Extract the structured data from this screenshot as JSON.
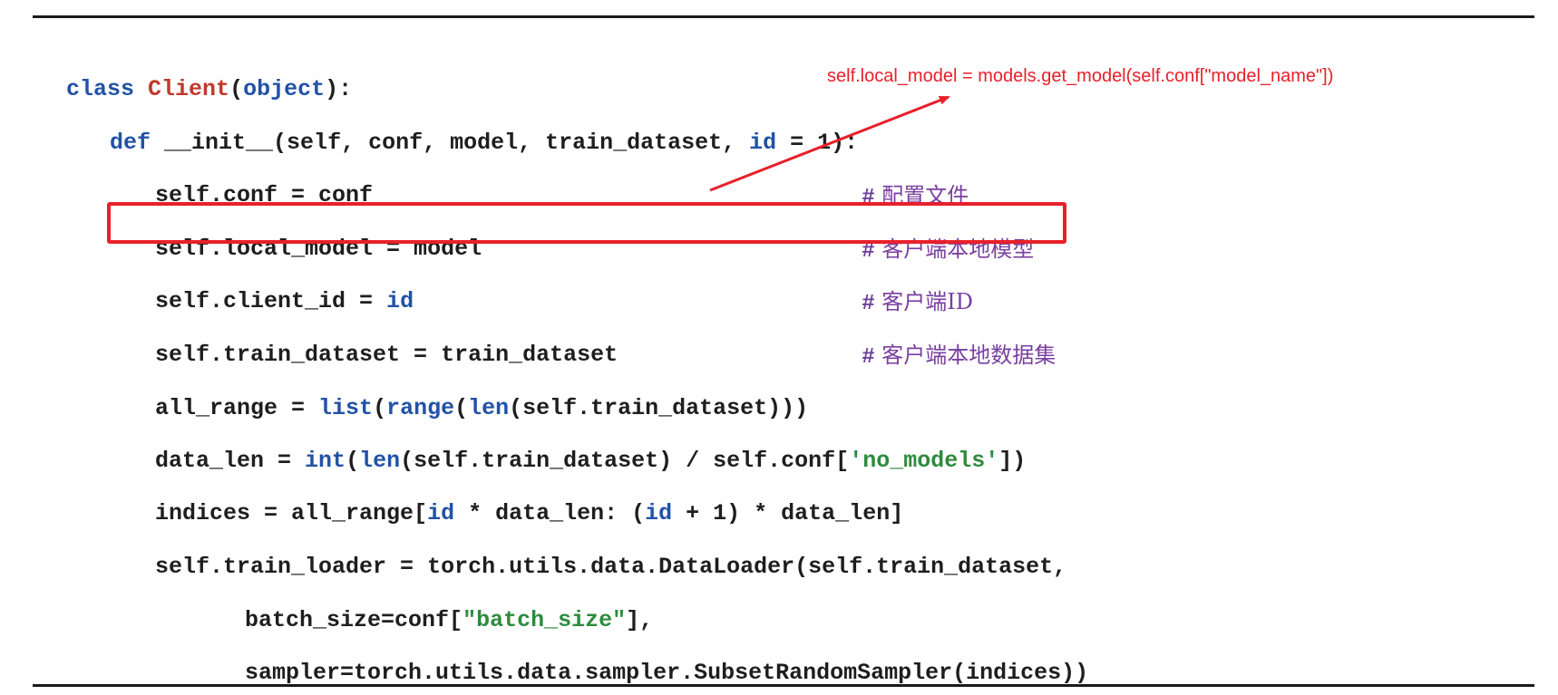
{
  "annotation": {
    "text": "self.local_model = models.get_model(self.conf[\"model_name\"])"
  },
  "code": {
    "line1": {
      "kw_class": "class",
      "name": "Client",
      "open": "(",
      "base": "object",
      "close": "):"
    },
    "line2": {
      "kw_def": "def",
      "sig": " __init__(self, conf, model, train_dataset, ",
      "id_kw": "id",
      "rest": " = 1):"
    },
    "line3": {
      "text": "self.conf = conf"
    },
    "line4": {
      "text": "self.local_model = model"
    },
    "line5": {
      "pre": "self.client_id = ",
      "id_kw": "id"
    },
    "line6": {
      "text": "self.train_dataset = train_dataset"
    },
    "line7": {
      "pre": "all_range = ",
      "f1": "list",
      "p1": "(",
      "f2": "range",
      "p2": "(",
      "f3": "len",
      "rest": "(self.train_dataset)))"
    },
    "line8": {
      "pre": "data_len = ",
      "f1": "int",
      "p1": "(",
      "f2": "len",
      "mid": "(self.train_dataset) / self.conf[",
      "str": "'no_models'",
      "close": "])"
    },
    "line9": {
      "pre": "indices = all_range[",
      "id1": "id",
      "mid": " * data_len: (",
      "id2": "id",
      "rest": " + 1) * data_len]"
    },
    "line10": {
      "text": "self.train_loader = torch.utils.data.DataLoader(self.train_dataset,"
    },
    "line11": {
      "pre": "batch_size=conf[",
      "str": "\"batch_size\"",
      "close": "],"
    },
    "line12": {
      "text": "sampler=torch.utils.data.sampler.SubsetRandomSampler(indices))"
    }
  },
  "comments": {
    "c1": {
      "hash": "#",
      "text": " 配置文件"
    },
    "c2": {
      "hash": "#",
      "text": " 客户端本地模型"
    },
    "c3": {
      "hash": "#",
      "text": " 客户端ID"
    },
    "c4": {
      "hash": "#",
      "text": " 客户端本地数据集"
    }
  },
  "colors": {
    "keyword": "#2152a6",
    "class_name": "#c0392b",
    "string": "#2e8b3e",
    "comment": "#7a3fa0",
    "annotation": "#e8202a"
  }
}
